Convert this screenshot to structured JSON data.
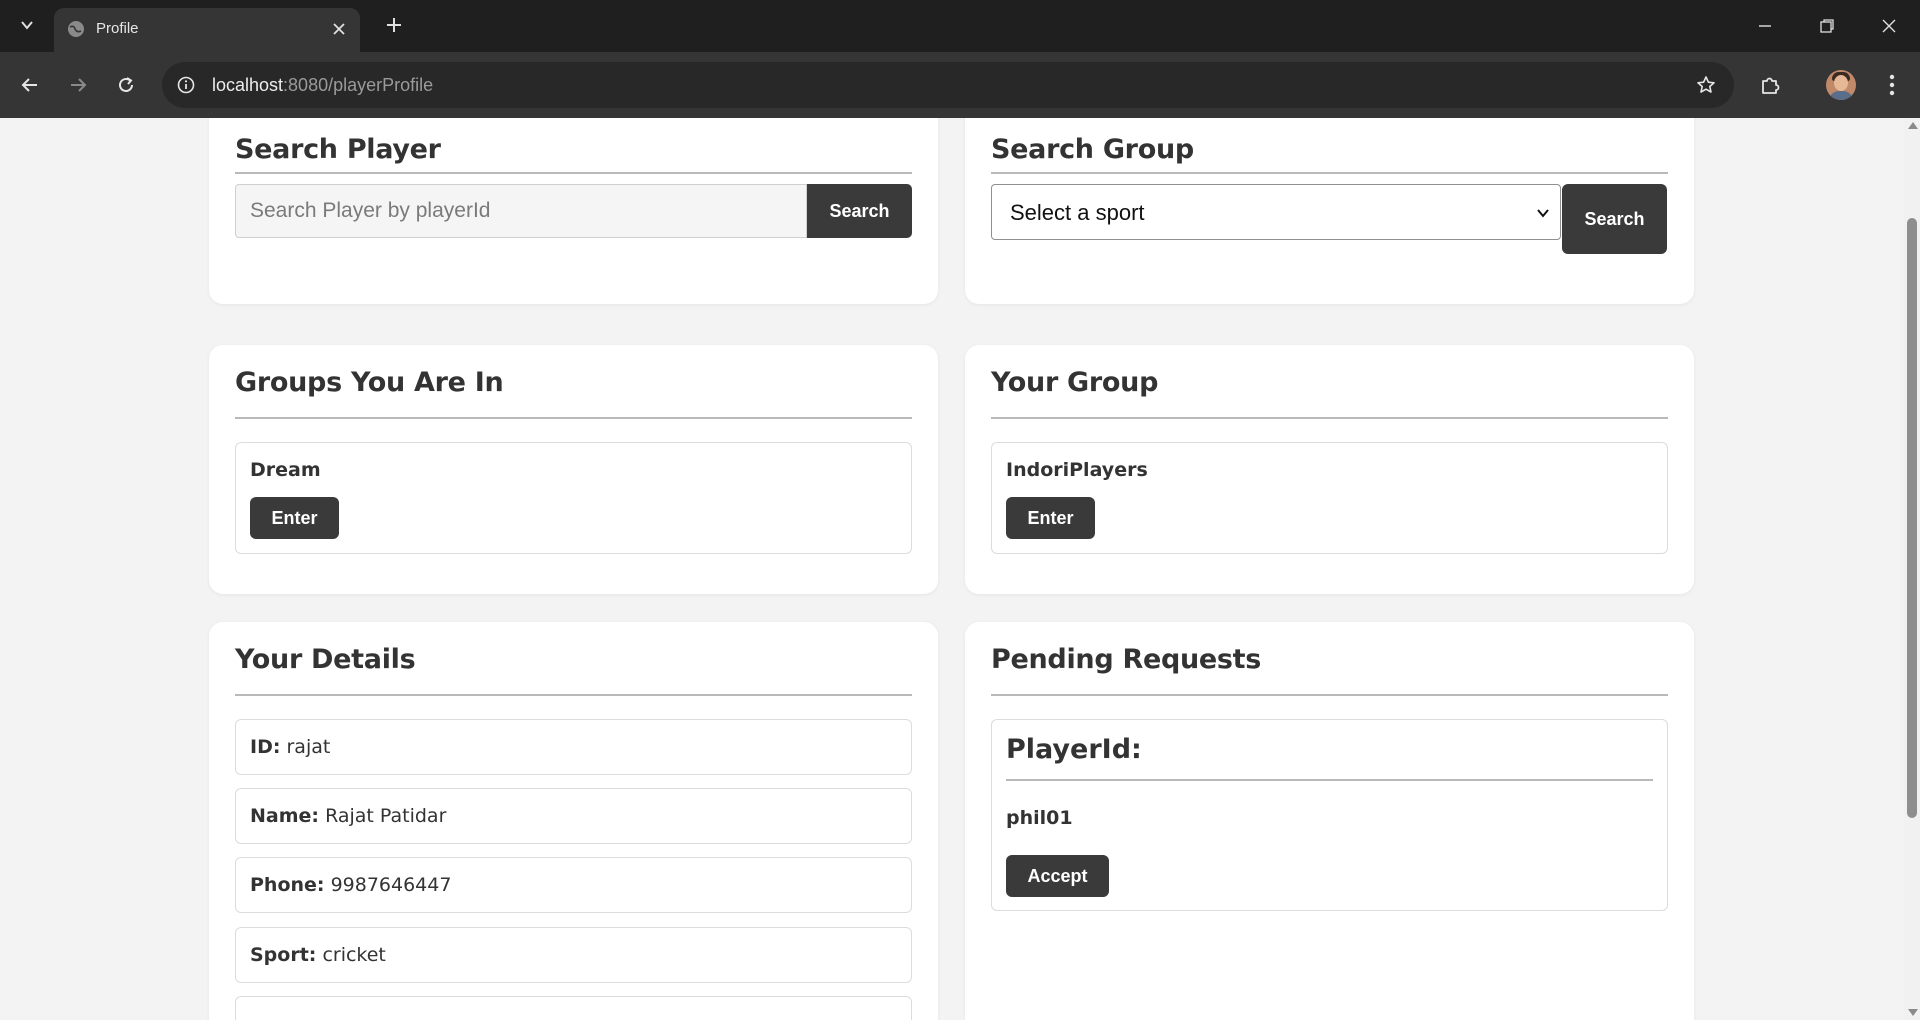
{
  "browser": {
    "tab_title": "Profile",
    "url_host": "localhost",
    "url_path": ":8080/playerProfile"
  },
  "search_player": {
    "title": "Search Player",
    "placeholder": "Search Player by playerId",
    "button": "Search"
  },
  "search_group": {
    "title": "Search Group",
    "select_value": "Select a sport",
    "button": "Search"
  },
  "groups_in": {
    "title": "Groups You Are In",
    "groups": [
      {
        "name": "Dream",
        "button": "Enter"
      }
    ]
  },
  "your_group": {
    "title": "Your Group",
    "groups": [
      {
        "name": "IndoriPlayers",
        "button": "Enter"
      }
    ]
  },
  "details": {
    "title": "Your Details",
    "rows": [
      {
        "label": "ID:",
        "value": "rajat"
      },
      {
        "label": "Name:",
        "value": "Rajat Patidar"
      },
      {
        "label": "Phone:",
        "value": "9987646447"
      },
      {
        "label": "Sport:",
        "value": "cricket"
      }
    ]
  },
  "pending": {
    "title": "Pending Requests",
    "heading": "PlayerId:",
    "requests": [
      {
        "player_id": "phil01",
        "button": "Accept"
      }
    ]
  },
  "colors": {
    "page_bg": "#f3f3f3",
    "card_bg": "#ffffff",
    "button_dark": "#3a3a3a",
    "chrome_dark": "#1f1f1f"
  }
}
